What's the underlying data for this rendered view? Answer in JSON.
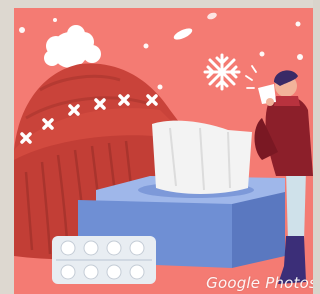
{
  "watermark": {
    "text": "Google Photos"
  },
  "colors": {
    "background_coral": "#f47b73",
    "hat_red": "#c9433a",
    "hat_shadow": "#a7332d",
    "tissue_box_blue": "#6f8fd4",
    "tissue_box_top": "#9fb7ea",
    "tissue_white": "#f3f3f3",
    "pill_pack": "#e8edf2",
    "person_sweater": "#8c1f2a",
    "person_pants": "#cfe1ea",
    "person_boots": "#3b2e78"
  },
  "icons": [
    "winter-hat",
    "snowflake",
    "tissue-box",
    "pill-blister-pack",
    "sick-person-with-tissue"
  ]
}
